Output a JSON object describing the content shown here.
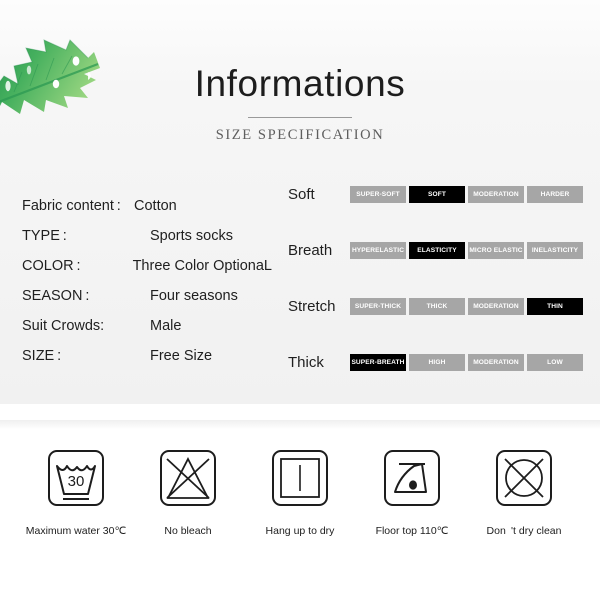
{
  "header": {
    "title": "Informations",
    "subtitle": "SIZE SPECIFICATION"
  },
  "decor": {
    "leaf_icon": "monstera-leaf-icon",
    "colors": {
      "leaf_dark": "#2f9b54",
      "leaf_mid": "#4cb462",
      "leaf_light": "#8fd07a"
    }
  },
  "theme": {
    "panel_background": "#f3f3f3",
    "text": "#1f1f1f",
    "segment_inactive": "#a6a6a6",
    "segment_active": "#000000",
    "segment_text": "#ffffff"
  },
  "specs": [
    {
      "key": "Fabric content :",
      "value": "Cotton"
    },
    {
      "key": "TYPE :",
      "value": "Sports socks"
    },
    {
      "key": "COLOR :",
      "value": "Three Color OptionaL"
    },
    {
      "key": "SEASON :",
      "value": "Four seasons"
    },
    {
      "key": "Suit Crowds:",
      "value": "Male"
    },
    {
      "key": "SIZE :",
      "value": "Free Size"
    }
  ],
  "properties": [
    {
      "label": "Soft",
      "segments": [
        {
          "text": "SUPER-SOFT",
          "active": false
        },
        {
          "text": "SOFT",
          "active": true
        },
        {
          "text": "MODERATION",
          "active": false
        },
        {
          "text": "HARDER",
          "active": false
        }
      ]
    },
    {
      "label": "Breath",
      "segments": [
        {
          "text": "HYPERELASTIC",
          "active": false
        },
        {
          "text": "ELASTICITY",
          "active": true
        },
        {
          "text": "MICRO ELASTIC",
          "active": false
        },
        {
          "text": "INELASTICITY",
          "active": false
        }
      ]
    },
    {
      "label": "Stretch",
      "segments": [
        {
          "text": "SUPER-THICK",
          "active": false
        },
        {
          "text": "THICK",
          "active": false
        },
        {
          "text": "MODERATION",
          "active": false
        },
        {
          "text": "THIN",
          "active": true
        }
      ]
    },
    {
      "label": "Thick",
      "segments": [
        {
          "text": "SUPER-BREATH",
          "active": true
        },
        {
          "text": "HIGH",
          "active": false
        },
        {
          "text": "MODERATION",
          "active": false
        },
        {
          "text": "LOW",
          "active": false
        }
      ]
    }
  ],
  "care_instructions": [
    {
      "icon": "wash-tub-30-icon",
      "caption": "Maximum water 30℃",
      "value": "30"
    },
    {
      "icon": "no-bleach-triangle-icon",
      "caption": "No bleach"
    },
    {
      "icon": "hang-dry-icon",
      "caption": "Hang up to dry"
    },
    {
      "icon": "iron-one-dot-icon",
      "caption": "Floor top 110℃"
    },
    {
      "icon": "no-dry-clean-icon",
      "caption": "Don 't dry clean"
    }
  ]
}
